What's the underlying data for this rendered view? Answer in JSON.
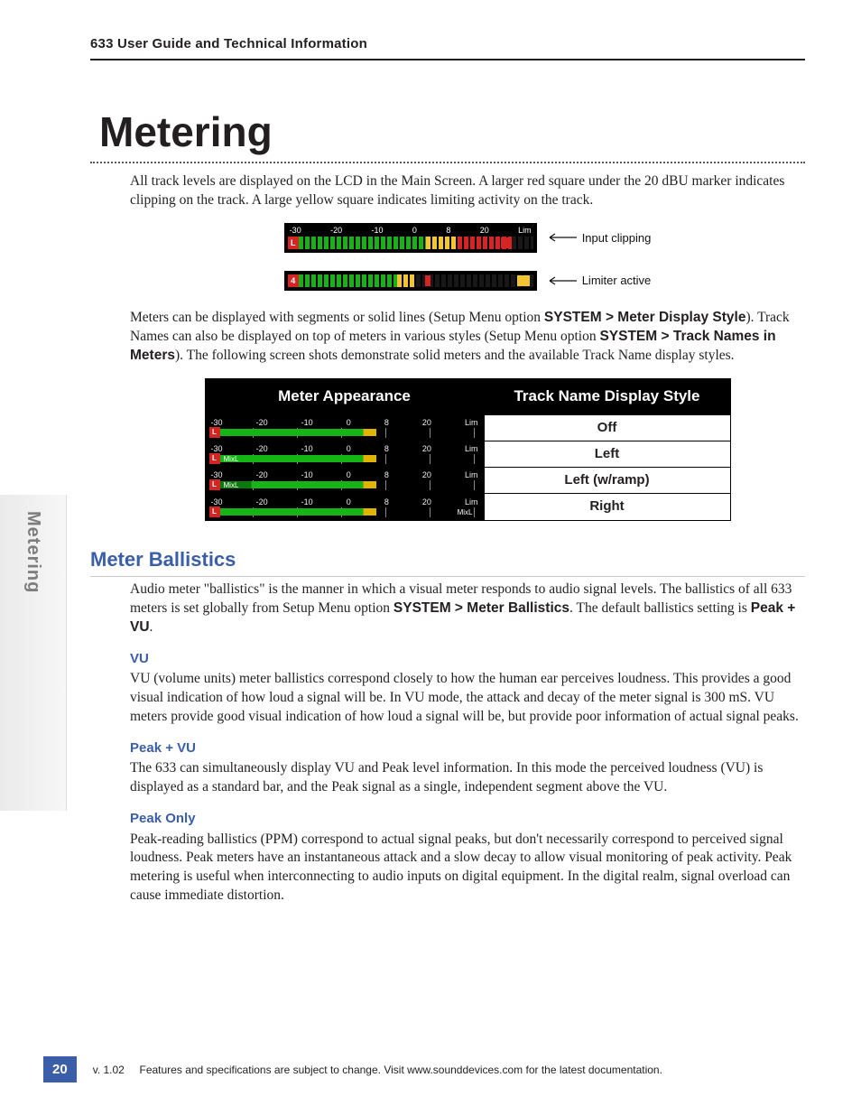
{
  "header": {
    "running": "633 User Guide and Technical Information"
  },
  "chapter": {
    "title": "Metering"
  },
  "intro": {
    "p1": "All track levels are displayed on the LCD in the Main Screen. A larger red square under the 20 dBU marker indicates clipping on the track. A large yellow square indicates limiting activity on the track."
  },
  "diagram": {
    "scale": {
      "n30": "-30",
      "n20": "-20",
      "n10": "-10",
      "zero": "0",
      "eight": "8",
      "twenty": "20",
      "lim": "Lim"
    },
    "row1": {
      "left_label": "L",
      "callout": "Input clipping"
    },
    "row2": {
      "left_label": "4",
      "callout": "Limiter active"
    }
  },
  "para2": {
    "a": "Meters can be displayed with segments or solid lines (Setup Menu option ",
    "b": "SYSTEM > Meter Display Style",
    "c": "). Track Names can also be displayed on top of meters in various styles (Setup Menu option ",
    "d": "SYSTEM > Track Names in Meters",
    "e": "). The following screen shots demonstrate solid meters and the available Track Name display styles."
  },
  "table": {
    "head": {
      "left": "Meter Appearance",
      "right": "Track Name Display Style"
    },
    "rows": [
      {
        "seg_label": "L",
        "tracklabel": "",
        "tracklabel_pos": "none",
        "style": "Off"
      },
      {
        "seg_label": "L",
        "tracklabel": "MixL",
        "tracklabel_pos": "left",
        "style": "Left"
      },
      {
        "seg_label": "L",
        "tracklabel": "MixL",
        "tracklabel_pos": "leftramp",
        "style": "Left (w/ramp)"
      },
      {
        "seg_label": "L",
        "tracklabel": "MixL",
        "tracklabel_pos": "right",
        "style": "Right"
      }
    ],
    "scale": {
      "n30": "-30",
      "n20": "-20",
      "n10": "-10",
      "zero": "0",
      "eight": "8",
      "twenty": "20",
      "lim": "Lim"
    }
  },
  "ballistics": {
    "heading": "Meter Ballistics",
    "p1a": "Audio meter \"ballistics\" is the manner in which a visual meter responds to audio signal levels. The ballistics of all 633 meters is set globally from Setup Menu option ",
    "p1b": "SYSTEM > Meter Ballistics",
    "p1c": ". The default ballistics setting is ",
    "p1d": "Peak + VU",
    "p1e": ".",
    "vu": {
      "h": "VU",
      "p": "VU (volume units) meter ballistics correspond closely to how the human ear perceives loudness. This provides a good visual indication of how loud a signal will be. In VU mode, the attack and decay of the meter signal is 300 mS. VU meters provide good visual indication of how loud a signal will be, but provide poor information of actual signal peaks."
    },
    "peakvu": {
      "h": "Peak + VU",
      "p": "The 633 can simultaneously display VU and Peak level information. In this mode the perceived loudness (VU) is displayed as a standard bar, and the Peak signal as a single, independent segment above the VU."
    },
    "peak": {
      "h": "Peak Only",
      "p": "Peak-reading ballistics (PPM) correspond to actual signal peaks, but don't necessarily correspond to perceived signal loudness. Peak meters have an instantaneous attack and a slow decay to allow visual monitoring of peak activity. Peak metering is useful when interconnecting to audio inputs on digital equipment. In the digital realm, signal overload can cause immediate distortion."
    }
  },
  "sidetab": {
    "label": "Metering"
  },
  "footer": {
    "page": "20",
    "ver": "v. 1.02",
    "note": "Features and specifications are subject to change. Visit www.sounddevices.com for the latest documentation."
  }
}
